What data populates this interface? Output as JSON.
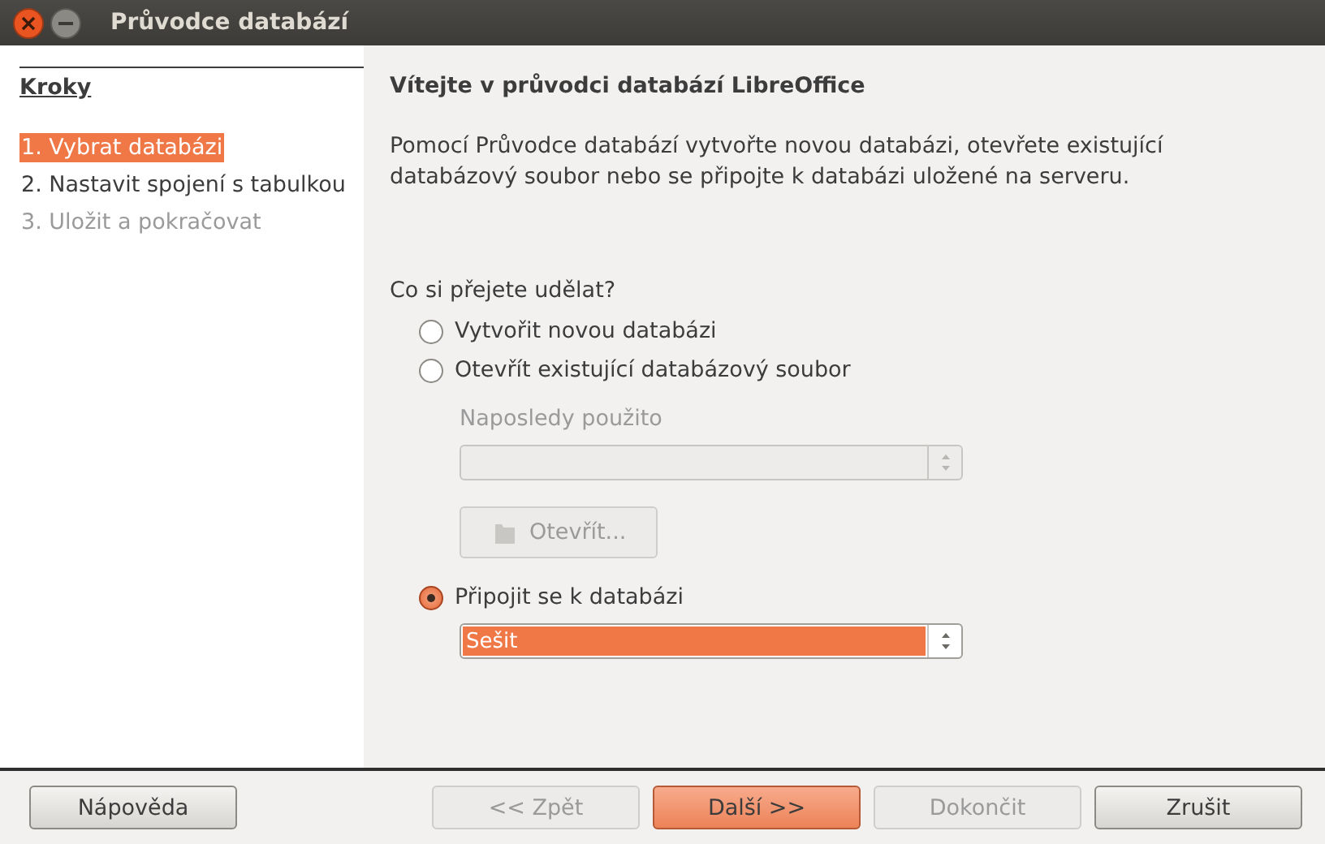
{
  "window": {
    "title": "Průvodce databází"
  },
  "sidebar": {
    "title": "Kroky",
    "items": [
      {
        "label": "1. Vybrat databázi",
        "selected": true,
        "disabled": false
      },
      {
        "label": "2. Nastavit spojení s tabulkou",
        "selected": false,
        "disabled": false
      },
      {
        "label": "3. Uložit a pokračovat",
        "selected": false,
        "disabled": true
      }
    ]
  },
  "main": {
    "heading": "Vítejte v průvodci databází LibreOffice",
    "intro": "Pomocí Průvodce databází vytvořte novou databázi, otevřete existující databázový soubor nebo se připojte k databázi uložené na serveru.",
    "question": "Co si přejete udělat?",
    "options": [
      {
        "kind": "radio",
        "label": "Vytvořit novou databázi",
        "selected": false
      },
      {
        "kind": "radio",
        "label": "Otevřít existující databázový soubor",
        "selected": false
      },
      {
        "kind": "label",
        "label": "Naposledy použito",
        "disabled": true
      },
      {
        "kind": "combo",
        "disabled": true,
        "highlighted": false
      },
      {
        "kind": "button",
        "label": "Otevřít...",
        "disabled": true
      },
      {
        "kind": "radio",
        "label": "Připojit se k databázi",
        "selected": true
      },
      {
        "kind": "combo",
        "value": "Sešit",
        "disabled": false,
        "highlighted": true
      }
    ]
  },
  "buttons": [
    {
      "label": "Nápověda",
      "disabled": false,
      "default": false
    },
    {
      "label": "<< Zpět",
      "disabled": true,
      "default": false
    },
    {
      "label": "Další >>",
      "disabled": false,
      "default": true
    },
    {
      "label": "Dokončit",
      "disabled": true,
      "default": false
    },
    {
      "label": "Zrušit",
      "disabled": false,
      "default": false
    }
  ]
}
